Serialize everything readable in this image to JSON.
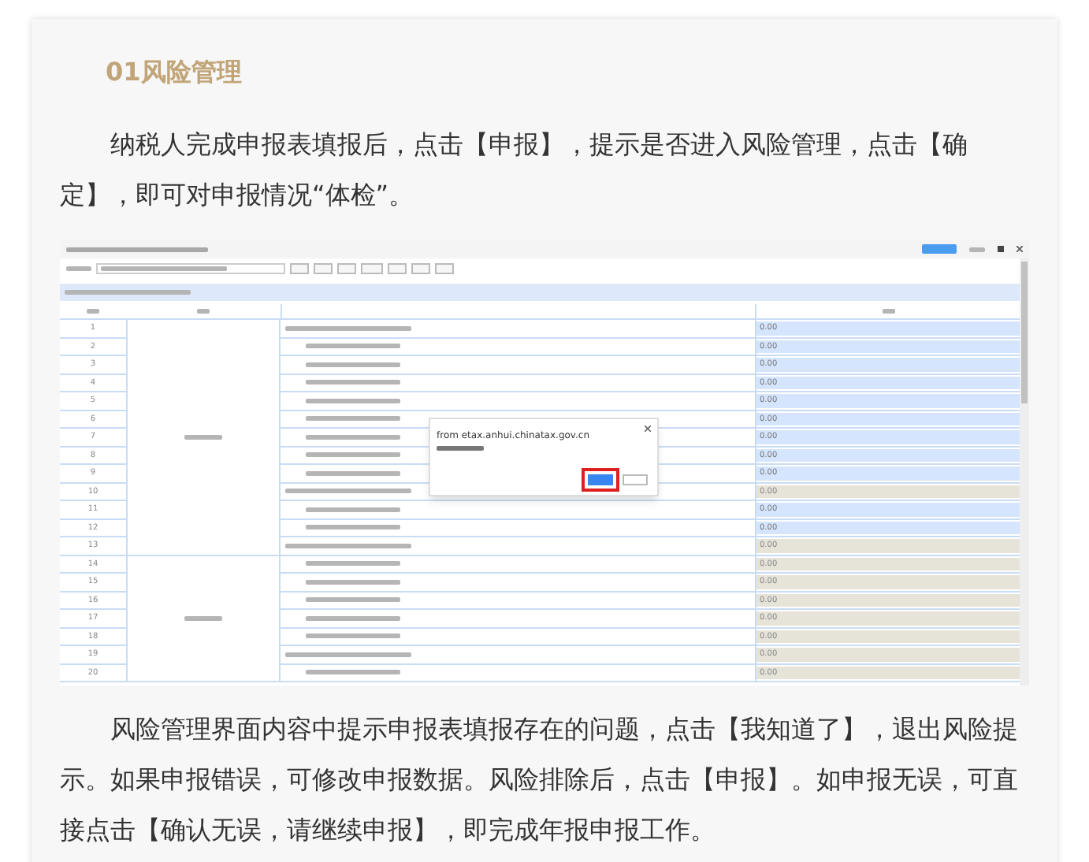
{
  "article": {
    "heading": "01风险管理",
    "paragraphs": [
      "纳税人完成申报表填报后，点击【申报】，提示是否进入风险管理，点击【确定】，即可对申报情况“体检”。"
    ]
  },
  "screenshot": {
    "groups": [
      {
        "rows": [
          {
            "number": "1",
            "kind": "section",
            "amount": "0.00",
            "editable": true
          },
          {
            "number": "2",
            "kind": "item",
            "amount": "0.00",
            "editable": true
          },
          {
            "number": "3",
            "kind": "item",
            "amount": "0.00",
            "editable": true
          },
          {
            "number": "4",
            "kind": "item",
            "amount": "0.00",
            "editable": true
          },
          {
            "number": "5",
            "kind": "item",
            "amount": "0.00",
            "editable": true
          },
          {
            "number": "6",
            "kind": "item",
            "amount": "0.00",
            "editable": true
          },
          {
            "number": "7",
            "kind": "item",
            "amount": "0.00",
            "editable": true
          },
          {
            "number": "8",
            "kind": "item",
            "amount": "0.00",
            "editable": true
          },
          {
            "number": "9",
            "kind": "item",
            "amount": "0.00",
            "editable": true
          },
          {
            "number": "10",
            "kind": "section",
            "amount": "0.00",
            "editable": false
          },
          {
            "number": "11",
            "kind": "item",
            "amount": "0.00",
            "editable": true
          },
          {
            "number": "12",
            "kind": "item",
            "amount": "0.00",
            "editable": true
          },
          {
            "number": "13",
            "kind": "section",
            "amount": "0.00",
            "editable": false
          }
        ]
      },
      {
        "rows": [
          {
            "number": "14",
            "kind": "item",
            "amount": "0.00",
            "editable": false
          },
          {
            "number": "15",
            "kind": "item",
            "amount": "0.00",
            "editable": false
          },
          {
            "number": "16",
            "kind": "item",
            "amount": "0.00",
            "editable": false
          },
          {
            "number": "17",
            "kind": "item",
            "amount": "0.00",
            "editable": false
          },
          {
            "number": "18",
            "kind": "item",
            "amount": "0.00",
            "editable": false
          },
          {
            "number": "19",
            "kind": "section",
            "amount": "0.00",
            "editable": false
          },
          {
            "number": "20",
            "kind": "item",
            "amount": "0.00",
            "editable": false
          }
        ]
      }
    ],
    "dialog": {
      "source": "from etax.anhui.chinatax.gov.cn"
    }
  },
  "closing_paragraphs": [
    "风险管理界面内容中提示申报表填报存在的问题，点击【我知道了】，退出风险提示。如果申报错误，可修改申报数据。风险排除后，点击【申报】。如申报无误，可直接点击【确认无误，请继续申报】，即完成年报申报工作。"
  ]
}
